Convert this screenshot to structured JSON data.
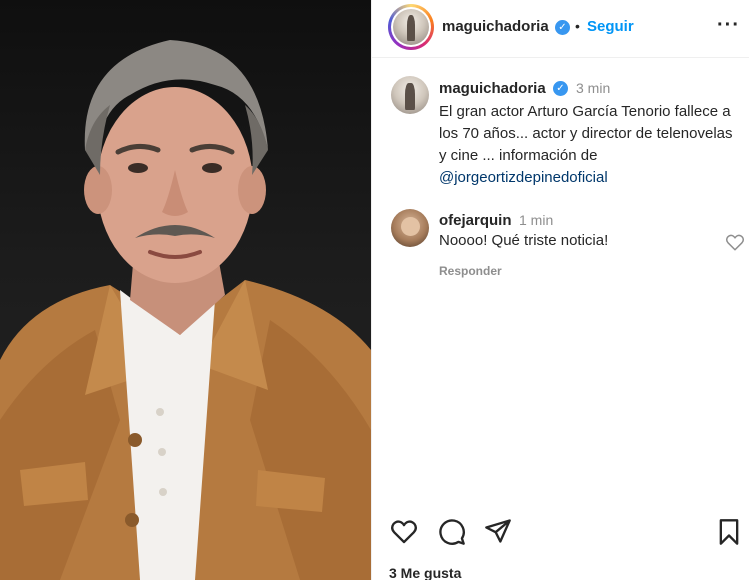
{
  "post": {
    "image": {
      "subject": "portrait-photo"
    },
    "header": {
      "username": "maguichadoria",
      "verified_glyph": "✓",
      "separator": "•",
      "follow_label": "Seguir",
      "more_glyph": "···"
    },
    "caption": {
      "username": "maguichadoria",
      "time": "3 min",
      "text": "El gran actor Arturo García Tenorio fallece a los 70 años... actor y director de telenovelas y cine ... información de ",
      "mention": "@jorgeortizdepinedoficial"
    },
    "comment": {
      "username": "ofejarquin",
      "time": "1 min",
      "text": "Noooo! Qué triste noticia!",
      "reply_label": "Responder"
    },
    "actions": {
      "icons": [
        "heart-icon",
        "comment-icon",
        "share-icon",
        "bookmark-icon"
      ]
    },
    "likes": "3 Me gusta"
  },
  "colors": {
    "accent": "#0095f6",
    "verified": "#3897f0",
    "mention": "#00376b",
    "muted": "#8e8e8e",
    "text": "#262626"
  }
}
